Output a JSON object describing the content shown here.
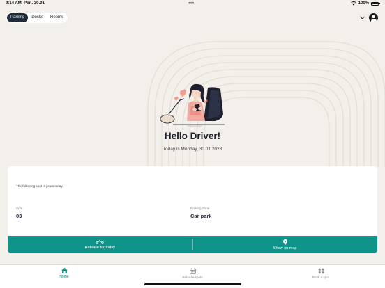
{
  "status_bar": {
    "time": "9:14 AM",
    "date": "Pon. 30.01",
    "dots": "•••",
    "battery": "100%"
  },
  "tabs": [
    {
      "label": "Parking",
      "active": true
    },
    {
      "label": "Desks",
      "active": false
    },
    {
      "label": "Rooms",
      "active": false
    }
  ],
  "header": {
    "dropdown_icon": "chevron-down-icon",
    "avatar_icon": "user-avatar-icon"
  },
  "main": {
    "greeting": "Hello Driver!",
    "date_line": "Today is Monday, 30.01.2023"
  },
  "card": {
    "intro": "The following spot is yours today:",
    "spot_label": "Spot",
    "spot_value": "03",
    "zone_label": "Parking Zone",
    "zone_value": "Car park",
    "release_label": "Release for today",
    "map_label": "Show on map"
  },
  "bottom_nav": {
    "home": "Home",
    "release": "Release spots",
    "book": "Book a spot"
  },
  "colors": {
    "accent": "#0e9488",
    "background": "#f3efea",
    "tab_active": "#1e2a3a",
    "text_dark": "#1e2030"
  }
}
